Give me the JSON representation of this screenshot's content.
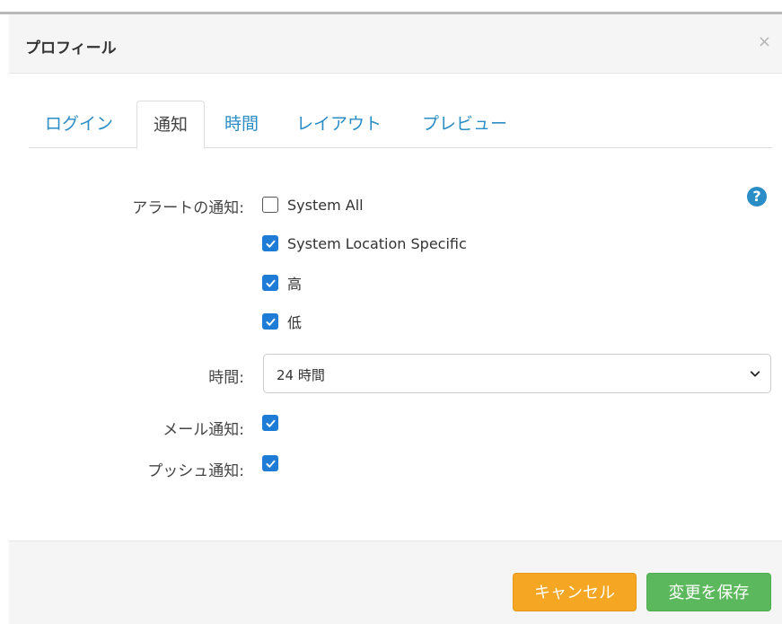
{
  "modal": {
    "title": "プロフィール",
    "close_label": "×"
  },
  "tabs": [
    {
      "label": "ログイン",
      "active": false
    },
    {
      "label": "通知",
      "active": true
    },
    {
      "label": "時間",
      "active": false
    },
    {
      "label": "レイアウト",
      "active": false
    },
    {
      "label": "プレビュー",
      "active": false
    }
  ],
  "help_icon": "question-circle-icon",
  "form": {
    "alert_label": "アラートの通知:",
    "alerts": [
      {
        "label": "System All",
        "checked": false
      },
      {
        "label": "System Location Specific",
        "checked": true
      },
      {
        "label": "高",
        "checked": true
      },
      {
        "label": "低",
        "checked": true
      }
    ],
    "time_label": "時間:",
    "time_select_value": "24 時間",
    "email_label": "メール通知:",
    "email_checked": true,
    "push_label": "プッシュ通知:",
    "push_checked": true
  },
  "footer": {
    "cancel_label": "キャンセル",
    "save_label": "変更を保存"
  },
  "colors": {
    "accent": "#2a8dc5",
    "checkbox": "#1e7cd6",
    "cancel": "#f5a623",
    "save": "#5cb85c"
  }
}
